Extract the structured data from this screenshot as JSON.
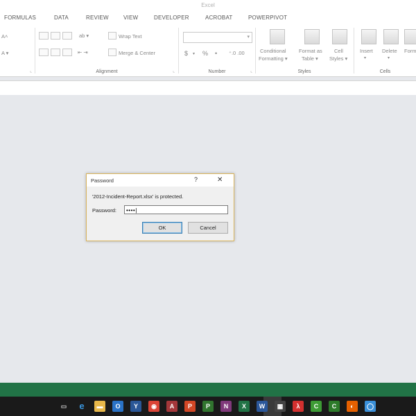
{
  "window": {
    "title": "Excel"
  },
  "ribbon_tabs": [
    "FORMULAS",
    "DATA",
    "REVIEW",
    "VIEW",
    "DEVELOPER",
    "ACROBAT",
    "POWERPIVOT"
  ],
  "ribbon": {
    "alignment": {
      "label": "Alignment",
      "wrap_text": "Wrap Text",
      "merge_center": "Merge & Center"
    },
    "number": {
      "label": "Number",
      "currency": "$",
      "percent": "%",
      "comma": "•",
      "decimals": "⁺.0 .00"
    },
    "styles": {
      "label": "Styles",
      "conditional_1": "Conditional",
      "conditional_2": "Formatting ▾",
      "format_table_1": "Format as",
      "format_table_2": "Table ▾",
      "cell_styles_1": "Cell",
      "cell_styles_2": "Styles ▾"
    },
    "cells": {
      "label": "Cells",
      "insert": "Insert",
      "delete": "Delete",
      "format": "Form"
    }
  },
  "dialog": {
    "title": "Password",
    "help": "?",
    "close": "✕",
    "message": "'2012-Incident-Report.xlsx' is protected.",
    "password_label": "Password:",
    "password_value": "••••|",
    "ok_label": "OK",
    "cancel_label": "Cancel"
  },
  "taskbar": {
    "icons": [
      {
        "name": "task-view-icon",
        "glyph": "▭",
        "color": "#1a1a1a"
      },
      {
        "name": "edge-icon",
        "glyph": "e",
        "color": "#1a1a1a"
      },
      {
        "name": "file-explorer-icon",
        "glyph": "▬",
        "color": "#e8b84a"
      },
      {
        "name": "outlook-icon",
        "glyph": "O",
        "color": "#2a72c6"
      },
      {
        "name": "yammer-icon",
        "glyph": "Y",
        "color": "#2b5797"
      },
      {
        "name": "chrome-icon",
        "glyph": "◉",
        "color": "#db4437"
      },
      {
        "name": "access-icon",
        "glyph": "A",
        "color": "#a4373a"
      },
      {
        "name": "powerpoint-icon",
        "glyph": "P",
        "color": "#d24726"
      },
      {
        "name": "project-icon",
        "glyph": "P",
        "color": "#31752f"
      },
      {
        "name": "onenote-icon",
        "glyph": "N",
        "color": "#80397b"
      },
      {
        "name": "excel-icon",
        "glyph": "X",
        "color": "#217346"
      },
      {
        "name": "word-icon",
        "glyph": "W",
        "color": "#2b579a"
      },
      {
        "name": "calculator-icon",
        "glyph": "▦",
        "color": "#444444"
      },
      {
        "name": "acrobat-icon",
        "glyph": "λ",
        "color": "#d3302f"
      },
      {
        "name": "camtasia-icon",
        "glyph": "C",
        "color": "#3d9b35"
      },
      {
        "name": "camtasia-recorder-icon",
        "glyph": "C",
        "color": "#2d7a2a"
      },
      {
        "name": "firefox-icon",
        "glyph": "◐",
        "color": "#e66000"
      },
      {
        "name": "more-icon",
        "glyph": "◯",
        "color": "#3a8fd8"
      }
    ]
  }
}
